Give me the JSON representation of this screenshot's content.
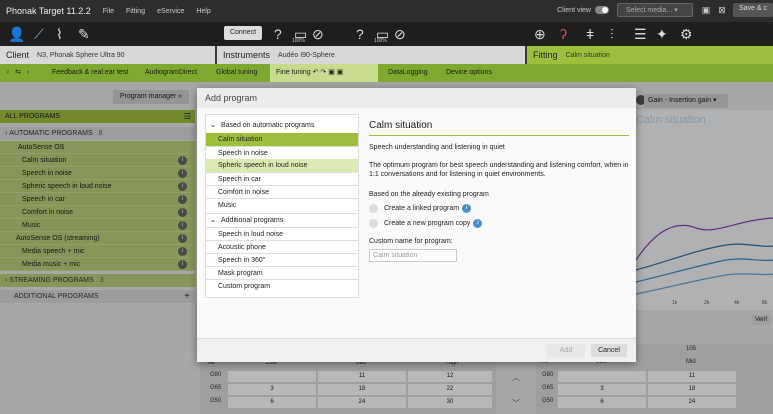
{
  "app": {
    "title": "Phonak Target 11.2.2",
    "menu": [
      "File",
      "Fitting",
      "eService",
      "Help"
    ],
    "client_view_label": "Client view",
    "select_media": "Select media...",
    "save_label": "Save & c"
  },
  "toolbar": {
    "connect_label": "Connect",
    "battery_left": "100%",
    "battery_right": "100%"
  },
  "sections": {
    "client_label": "Client",
    "client_value": "N3, Phonak Sphere Ultra 90",
    "instruments_label": "Instruments",
    "instruments_value": "Audéo I90-Sphere",
    "fitting_label": "Fitting",
    "fitting_value": "Calm situation"
  },
  "nav": {
    "tabs": [
      "Feedback & real ear test",
      "AudiogramDirect",
      "Global tuning",
      "Fine tuning",
      "DataLogging",
      "Device options"
    ],
    "active_tab": "Fine tuning"
  },
  "program_manager_label": "Program manager",
  "left_panel": {
    "all_programs": "ALL PROGRAMS",
    "automatic_programs": "AUTOMATIC PROGRAMS",
    "automatic_count": "8",
    "automatic_items": [
      "AutoSense OS",
      "Calm situation",
      "Speech in noise",
      "Spheric speech in loud noise",
      "Speech in car",
      "Comfort in noise",
      "Music",
      "AutoSense OS (streaming)",
      "Media speech + mic",
      "Media music + mic"
    ],
    "streaming_programs": "STREAMING PROGRAMS",
    "streaming_count": "3",
    "additional_programs": "ADDITIONAL PROGRAMS"
  },
  "chart_panel": {
    "gain_label": "Gain - Insertion gain",
    "chart_title": "Calm situation",
    "ticks": [
      "1k",
      "2k",
      "4k",
      "8k"
    ],
    "verify_label": "Verif"
  },
  "bottom_tables": {
    "left": {
      "headers": [
        "All",
        "Low",
        "Mid",
        "High"
      ],
      "rows": [
        {
          "label": "G80",
          "values": [
            "",
            "11",
            "12"
          ]
        },
        {
          "label": "G65",
          "values": [
            "3",
            "18",
            "22"
          ]
        },
        {
          "label": "G50",
          "values": [
            "6",
            "24",
            "30"
          ]
        }
      ]
    },
    "right": {
      "top_value": "105",
      "headers": [
        "All",
        "Low",
        "Mid"
      ],
      "rows": [
        {
          "label": "G80",
          "values": [
            "",
            "11"
          ]
        },
        {
          "label": "G65",
          "values": [
            "3",
            "18"
          ]
        },
        {
          "label": "G50",
          "values": [
            "6",
            "24"
          ]
        }
      ]
    }
  },
  "dialog": {
    "title": "Add program",
    "category_automatic": "Based on automatic programs",
    "automatic_options": [
      "Calm situation",
      "Speech in noise",
      "Spheric speech in loud noise",
      "Speech in car",
      "Comfort in noise",
      "Music"
    ],
    "category_additional": "Additional programs",
    "additional_options": [
      "Speech in loud noise",
      "Acoustic phone",
      "Speech in 360°",
      "Mask program",
      "Custom program"
    ],
    "selected": "Calm situation",
    "hovered": "Spheric speech in loud noise",
    "detail_title": "Calm situation",
    "detail_subtitle": "Speech understanding and listening in quiet",
    "detail_description": "The optimum program for best speech understanding and listening comfort, when in 1:1 conversations and for listening in quiet environments.",
    "based_on_label": "Based on the already existing program",
    "radio_linked": "Create a linked program",
    "radio_copy": "Create a new program copy",
    "custom_name_label": "Custom name for program:",
    "custom_name_placeholder": "Calm situation",
    "add_label": "Add",
    "cancel_label": "Cancel"
  }
}
